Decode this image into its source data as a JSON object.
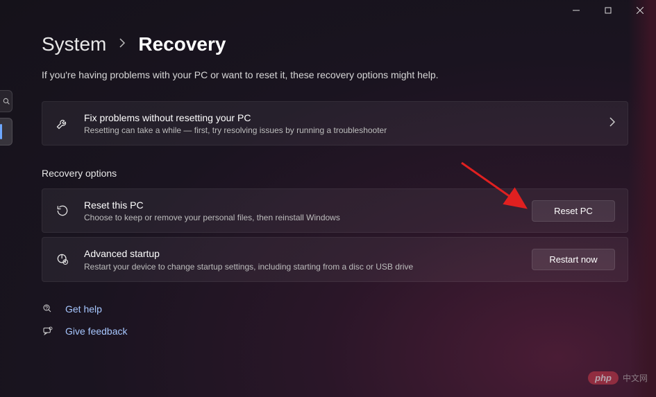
{
  "titlebar": {
    "minimize": "minimize",
    "maximize": "maximize",
    "close": "close"
  },
  "breadcrumb": {
    "root": "System",
    "current": "Recovery"
  },
  "subtitle": "If you're having problems with your PC or want to reset it, these recovery options might help.",
  "troubleshoot": {
    "title": "Fix problems without resetting your PC",
    "desc": "Resetting can take a while — first, try resolving issues by running a troubleshooter"
  },
  "sectionHeader": "Recovery options",
  "reset": {
    "title": "Reset this PC",
    "desc": "Choose to keep or remove your personal files, then reinstall Windows",
    "button": "Reset PC"
  },
  "advanced": {
    "title": "Advanced startup",
    "desc": "Restart your device to change startup settings, including starting from a disc or USB drive",
    "button": "Restart now"
  },
  "footer": {
    "help": "Get help",
    "feedback": "Give feedback"
  },
  "watermark": {
    "logo": "php",
    "text": "中文网"
  }
}
